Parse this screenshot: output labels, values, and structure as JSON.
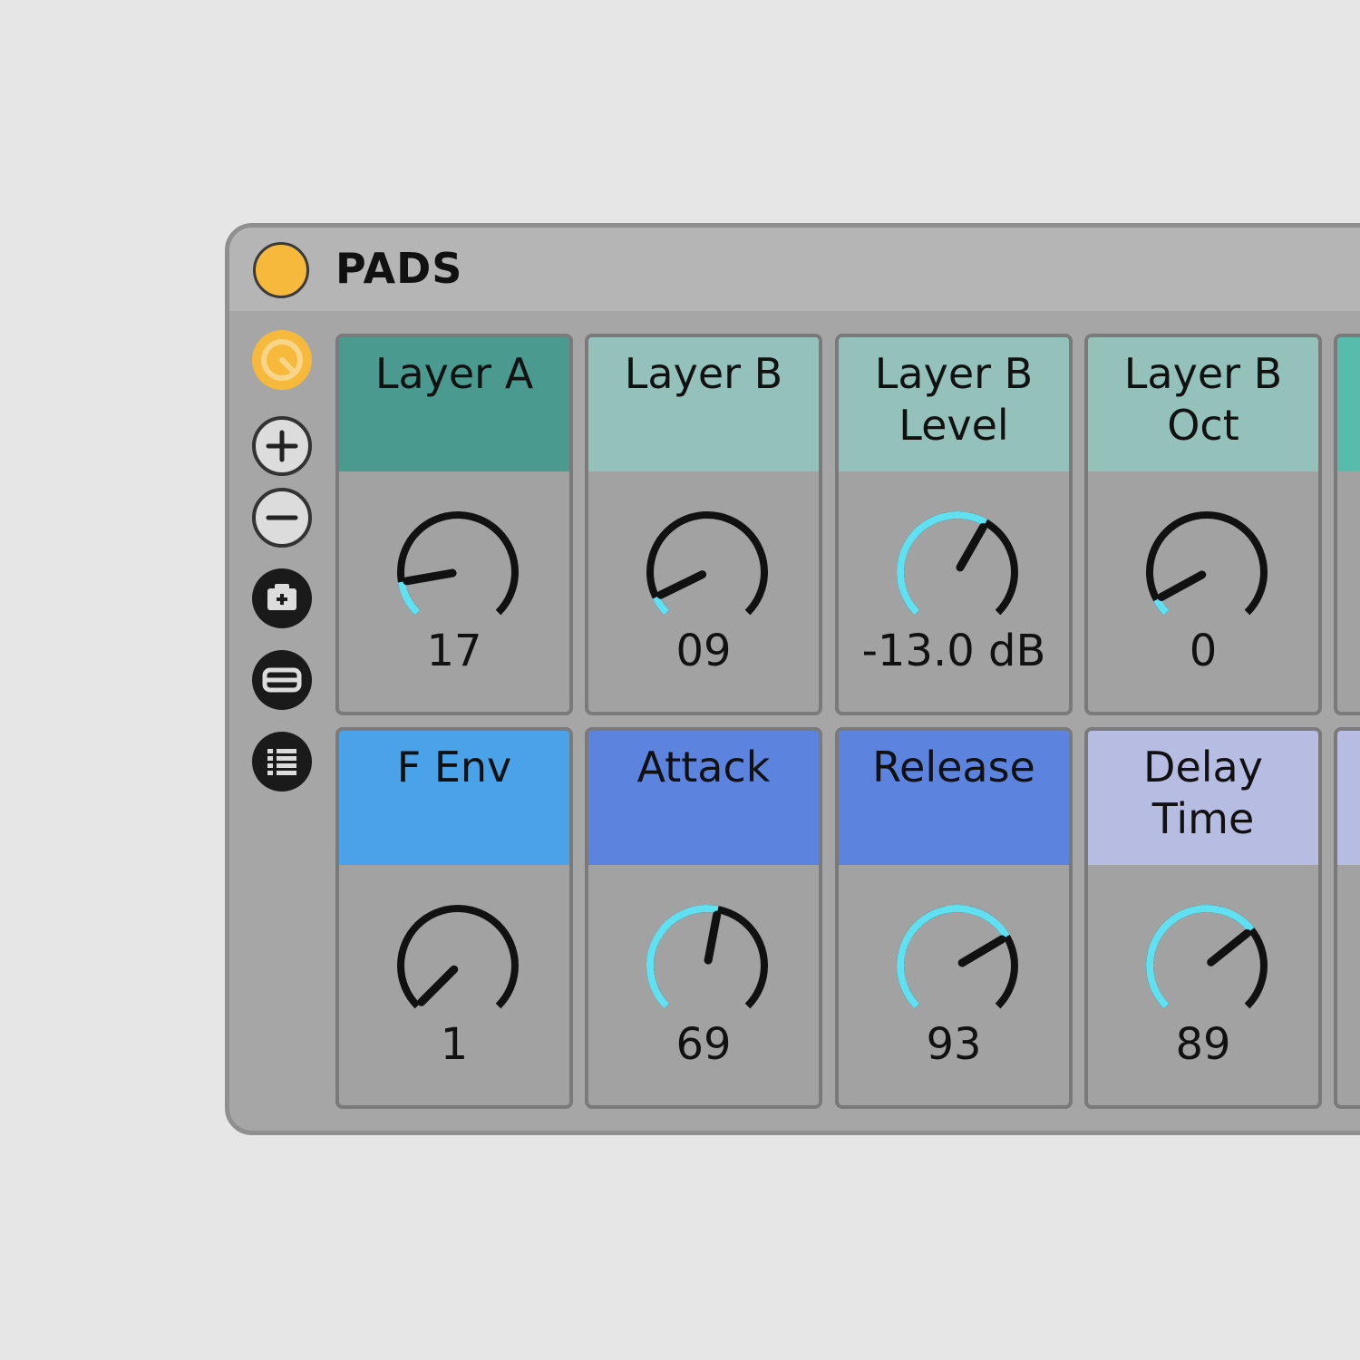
{
  "device": {
    "title": "PADS",
    "power_on": true,
    "accent_color": "#f6b93b"
  },
  "sidebar": {
    "buttons": [
      {
        "icon": "macro-map-icon",
        "active": true
      },
      {
        "icon": "plus-icon"
      },
      {
        "icon": "minus-icon"
      },
      {
        "icon": "snapshot-icon"
      },
      {
        "icon": "randomize-icon"
      },
      {
        "icon": "list-icon"
      }
    ]
  },
  "macros": [
    {
      "label": "Layer A",
      "value": "17",
      "color": "#4a9a90",
      "fraction": 0.13
    },
    {
      "label": "Layer B",
      "value": "09",
      "color": "#94c1ba",
      "fraction": 0.07
    },
    {
      "label": "Layer B Level",
      "value": "-13.0 dB",
      "color": "#94c1ba",
      "fraction": 0.61
    },
    {
      "label": "Layer B Oct",
      "value": "0",
      "color": "#94c1ba",
      "fraction": 0.06
    },
    {
      "label": "F Env",
      "value": "1",
      "color": "#4aa3e8",
      "fraction": 0.0
    },
    {
      "label": "Attack",
      "value": "69",
      "color": "#5c83de",
      "fraction": 0.54
    },
    {
      "label": "Release",
      "value": "93",
      "color": "#5c83de",
      "fraction": 0.72
    },
    {
      "label": "Delay Time",
      "value": "89",
      "color": "#b7bde2",
      "fraction": 0.69
    }
  ],
  "partial_columns": [
    {
      "color": "#58bcad"
    },
    {
      "color": "#b7bde2"
    }
  ]
}
